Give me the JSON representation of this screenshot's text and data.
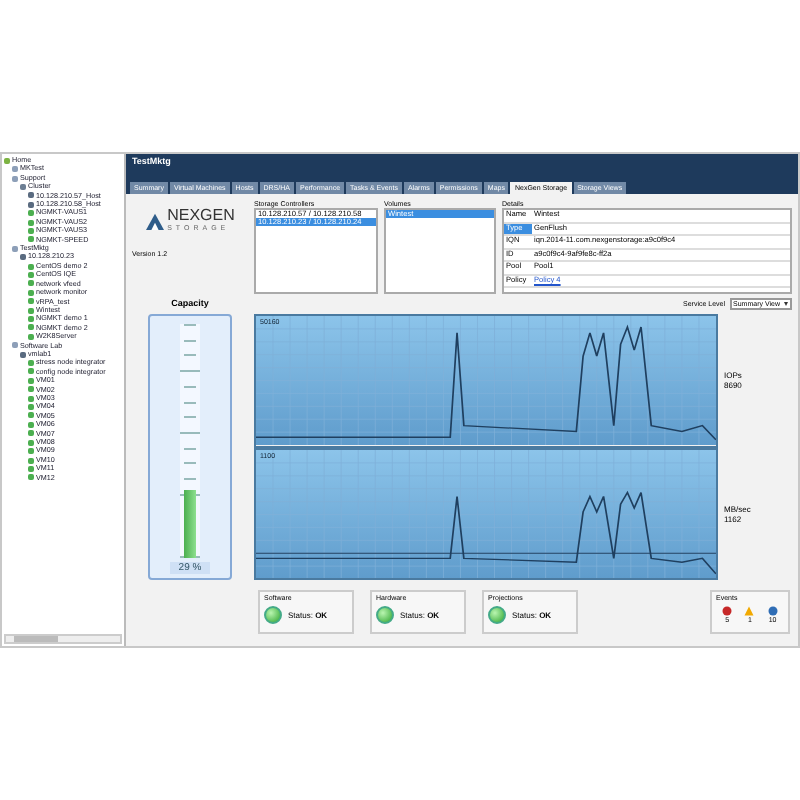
{
  "tree": [
    {
      "label": "Home",
      "kind": "home",
      "children": [
        {
          "label": "MKTest",
          "kind": "folder"
        },
        {
          "label": "Support",
          "kind": "folder",
          "children": [
            {
              "label": "Cluster",
              "kind": "cluster",
              "children": [
                {
                  "label": "10.128.210.57_Host",
                  "kind": "host"
                },
                {
                  "label": "10.128.210.58_Host",
                  "kind": "host"
                },
                {
                  "label": "NGMKT-VAUS1",
                  "kind": "vm"
                },
                {
                  "label": "NGMKT-VAUS2",
                  "kind": "vm"
                },
                {
                  "label": "NGMKT-VAUS3",
                  "kind": "vm"
                },
                {
                  "label": "NGMKT-SPEED",
                  "kind": "vm"
                }
              ]
            }
          ]
        },
        {
          "label": "TestMktg",
          "kind": "folder",
          "children": [
            {
              "label": "10.128.210.23",
              "kind": "host",
              "children": [
                {
                  "label": "CentOS demo 2",
                  "kind": "vm"
                },
                {
                  "label": "CentOS IQE",
                  "kind": "vm"
                },
                {
                  "label": "network vfeed",
                  "kind": "vm"
                },
                {
                  "label": "network monitor",
                  "kind": "vm"
                },
                {
                  "label": "vRPA_test",
                  "kind": "vm"
                },
                {
                  "label": "Wintest",
                  "kind": "vm"
                },
                {
                  "label": "NGMKT demo 1",
                  "kind": "vm"
                },
                {
                  "label": "NGMKT demo 2",
                  "kind": "vm"
                },
                {
                  "label": "W2K8Server",
                  "kind": "vm"
                }
              ]
            }
          ]
        },
        {
          "label": "Software Lab",
          "kind": "folder",
          "children": [
            {
              "label": "vmlab1",
              "kind": "host",
              "children": [
                {
                  "label": "stress node integrator",
                  "kind": "vm"
                },
                {
                  "label": "config node integrator",
                  "kind": "vm"
                },
                {
                  "label": "VM01",
                  "kind": "vm"
                },
                {
                  "label": "VM02",
                  "kind": "vm"
                },
                {
                  "label": "VM03",
                  "kind": "vm"
                },
                {
                  "label": "VM04",
                  "kind": "vm"
                },
                {
                  "label": "VM05",
                  "kind": "vm"
                },
                {
                  "label": "VM06",
                  "kind": "vm"
                },
                {
                  "label": "VM07",
                  "kind": "vm"
                },
                {
                  "label": "VM08",
                  "kind": "vm"
                },
                {
                  "label": "VM09",
                  "kind": "vm"
                },
                {
                  "label": "VM10",
                  "kind": "vm"
                },
                {
                  "label": "VM11",
                  "kind": "vm"
                },
                {
                  "label": "VM12",
                  "kind": "vm"
                }
              ]
            }
          ]
        }
      ]
    }
  ],
  "title": "TestMktg",
  "tabs": [
    {
      "label": "Summary",
      "selected": false
    },
    {
      "label": "Virtual Machines",
      "selected": false
    },
    {
      "label": "Hosts",
      "selected": false
    },
    {
      "label": "DRS/HA",
      "selected": false
    },
    {
      "label": "Performance",
      "selected": false
    },
    {
      "label": "Tasks & Events",
      "selected": false
    },
    {
      "label": "Alarms",
      "selected": false
    },
    {
      "label": "Permissions",
      "selected": false
    },
    {
      "label": "Maps",
      "selected": false
    },
    {
      "label": "NexGen Storage",
      "selected": true
    },
    {
      "label": "Storage Views",
      "selected": false
    }
  ],
  "logo": {
    "name": "NEXGEN",
    "tagline": "STORAGE"
  },
  "version": "Version 1.2",
  "controllers": {
    "title": "Storage Controllers",
    "items": [
      {
        "label": "10.128.210.57 / 10.128.210.58",
        "selected": false
      },
      {
        "label": "10.128.210.23 / 10.128.210.24",
        "selected": true
      }
    ]
  },
  "volumes": {
    "title": "Volumes",
    "items": [
      {
        "label": "Wintest",
        "selected": true
      }
    ]
  },
  "details": {
    "title": "Details",
    "rows": [
      {
        "key": "Name",
        "value": "Wintest",
        "selected": false
      },
      {
        "key": "Type",
        "value": "GenFlush",
        "selected": true
      },
      {
        "key": "IQN",
        "value": "iqn.2014-11.com.nexgenstorage:a9c0f9c4",
        "selected": false
      },
      {
        "key": "ID",
        "value": "a9c0f9c4-9af9fe8c-ff2a",
        "selected": false
      },
      {
        "key": "Pool",
        "value": "Pool1",
        "selected": false
      },
      {
        "key": "Policy",
        "value": "Policy 4",
        "kind": "link",
        "selected": false
      }
    ]
  },
  "service_level": {
    "label": "Service Level",
    "value": "Summary View"
  },
  "capacity": {
    "title": "Capacity",
    "level": 0.29,
    "reading": "29 %"
  },
  "charts": [
    {
      "top_label": "50160",
      "side_label": "IOPs",
      "side_value": "8690"
    },
    {
      "top_label": "1100",
      "side_label": "MB/sec",
      "side_value": "1162"
    }
  ],
  "status": [
    {
      "title": "Software",
      "label": "Status:",
      "value": "OK"
    },
    {
      "title": "Hardware",
      "label": "Status:",
      "value": "OK"
    },
    {
      "title": "Projections",
      "label": "Status:",
      "value": "OK"
    }
  ],
  "events": {
    "title": "Events",
    "items": [
      {
        "kind": "error",
        "count": "5"
      },
      {
        "kind": "warning",
        "count": "1"
      },
      {
        "kind": "info",
        "count": "10"
      }
    ]
  }
}
